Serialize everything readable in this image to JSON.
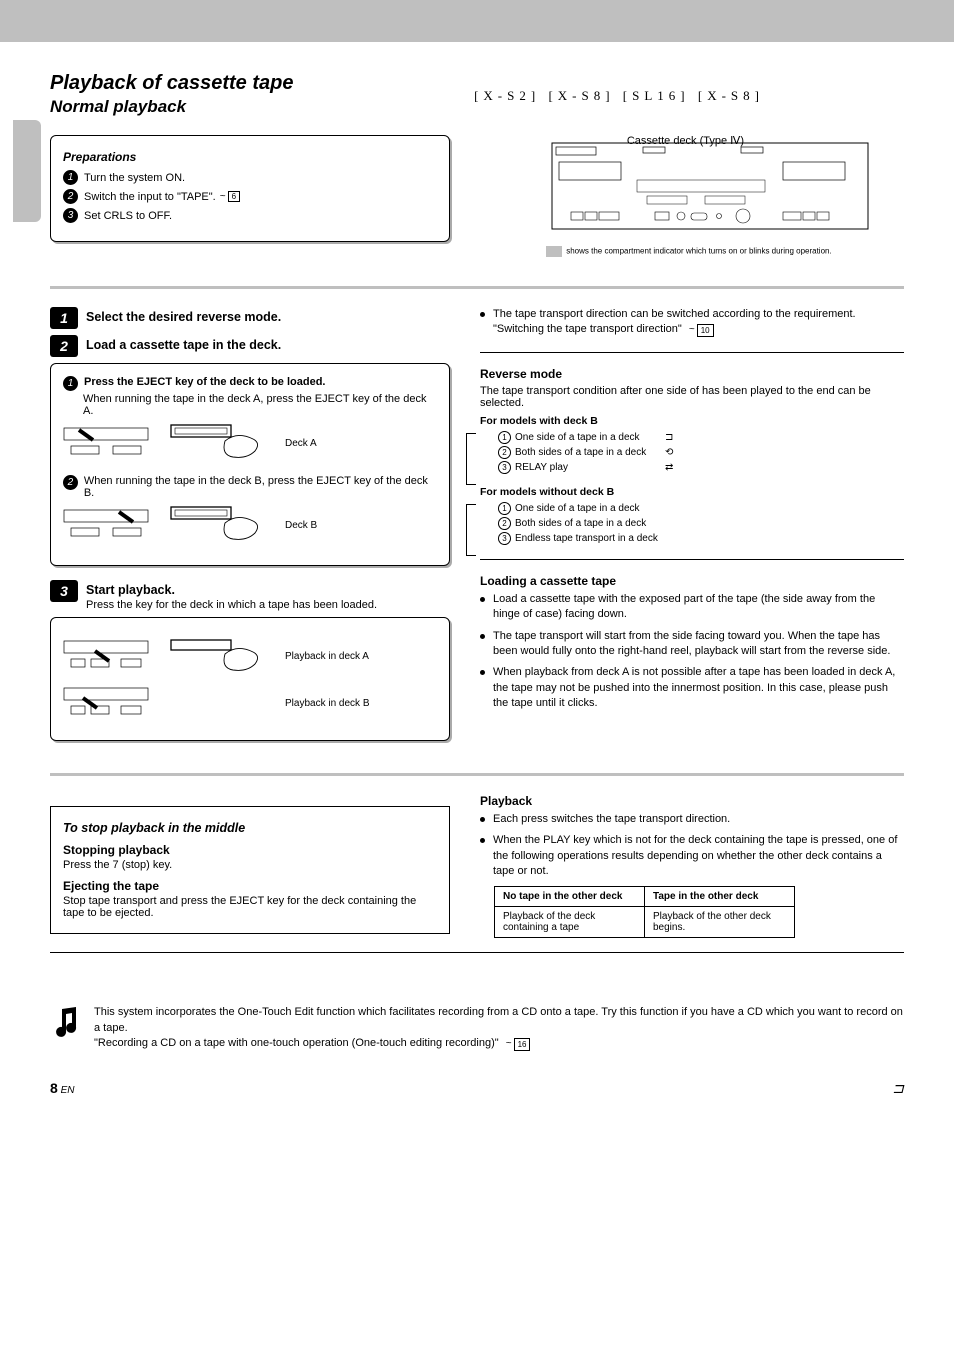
{
  "header": {
    "title_main": "Playback of cassette tape",
    "title_sub": "Normal playback",
    "models": "[X-S2] [X-S8] [SL16] [X-S8]",
    "unit_label": "Cassette deck (Type Ⅳ)",
    "indicator_hint": "shows the compartment indicator which turns on or blinks during operation."
  },
  "prep": {
    "heading": "Preparations",
    "line1": "Turn the system ON.",
    "line2_a": "Switch the input to \"TAPE\".",
    "line2_page": "6",
    "line3": "Set CRLS to OFF."
  },
  "step1": {
    "num": "1",
    "label": "Select the desired reverse mode."
  },
  "step2": {
    "num": "2",
    "label": "Load a cassette tape in the deck.",
    "inset_heading": "Press the EJECT key of the deck to be loaded.",
    "inset_line1": "When running the tape in the deck A, press the EJECT key of the deck A.",
    "inset_line2": "When running the tape in the deck B, press the EJECT key of the deck B.",
    "right_label_a": "Deck A",
    "right_label_b": "Deck B"
  },
  "step3": {
    "num": "3",
    "label": "Start playback.",
    "sub": "Press the key for the deck in which a tape has been loaded.",
    "inset_a": "Playback in deck A",
    "inset_b": "Playback in deck B"
  },
  "right1": {
    "bullet1": "The tape transport direction can be switched according to the requirement.",
    "bullet1_link": "\"Switching the tape transport direction\"",
    "page_ref": "10"
  },
  "reverse": {
    "heading": "Reverse mode",
    "p1": "The tape transport condition after one side of has been played to the end can be selected.",
    "models_with_b": "For models with deck B",
    "m1_1": "One side of a tape in a deck",
    "m1_2": "Both sides of a tape in a deck",
    "m1_3": "RELAY play",
    "i1": "⊐",
    "i2": "⟲",
    "i3": "⇄",
    "models_without_b": "For models without deck B",
    "m2_1": "One side of a tape in a deck",
    "m2_2": "Both sides of a tape in a deck",
    "m2_3": "Endless tape transport in a deck"
  },
  "loading": {
    "heading": "Loading a cassette tape",
    "b1": "Load a cassette tape with the exposed part of the tape (the side away from the hinge of case) facing down.",
    "b2": "The tape transport will start from the side facing toward you. When the tape has been would fully onto the right-hand reel, playback will start from the reverse side.",
    "b3": "When playback from deck A is not possible after a tape has been loaded in deck A, the tape may not be pushed into the innermost position. In this case, please push the tape until it clicks."
  },
  "playback": {
    "heading": "Playback",
    "b1": "Each press switches the tape transport direction.",
    "b2": "When the PLAY key which is not for the deck containing the tape is pressed, one of the following operations results depending on whether the other deck contains a tape or not."
  },
  "table": {
    "h_left": "No tape in the other deck",
    "h_right": "Tape in the other deck",
    "r1_left": "Playback of the deck containing a tape",
    "r1_right": "Playback of the other deck begins."
  },
  "pause": {
    "title": "To stop playback in the middle",
    "h1": "Stopping playback",
    "t1": "Press the 7 (stop) key.",
    "h2": "Ejecting the tape",
    "t2": "Stop tape transport and press the EJECT key for the deck containing the tape to be ejected."
  },
  "note": {
    "text_a": "This system incorporates the One-Touch Edit function which facilitates recording from a CD onto a tape. Try this function if you have a CD which you want to record on a tape.",
    "text_b": "\"Recording a CD on a tape with one-touch operation (One-touch editing recording)\"",
    "page_ref": "16"
  },
  "footer": {
    "page_num": "8",
    "label": "EN",
    "right_icon": "⊐"
  }
}
